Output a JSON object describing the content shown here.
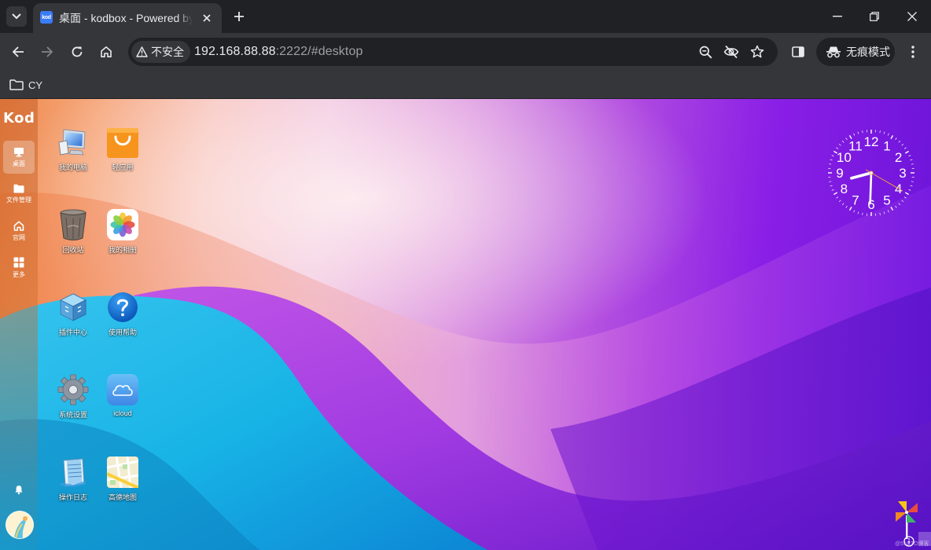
{
  "browser": {
    "tab": {
      "favicon_text": "kod",
      "title": "桌面 - kodbox - Powered by kodbox"
    },
    "security_label": "不安全",
    "url_host": "192.168.88.88",
    "url_rest": ":2222/#desktop",
    "incognito_label": "无痕模式",
    "bookmark_folder": "CY",
    "icons": [
      "tab-list-icon",
      "close-icon",
      "new-tab-icon",
      "minimize-icon",
      "restore-icon",
      "window-close-icon",
      "back-icon",
      "forward-icon",
      "reload-icon",
      "home-icon",
      "warning-icon",
      "zoom-icon",
      "eye-off-icon",
      "star-icon",
      "side-panel-icon",
      "incognito-icon",
      "menu-icon",
      "folder-icon"
    ]
  },
  "app": {
    "logo": "Kod",
    "sidebar": [
      {
        "label": "桌面",
        "icon": "desktop-icon",
        "active": true
      },
      {
        "label": "文件管理",
        "icon": "folder-icon",
        "active": false
      },
      {
        "label": "官网",
        "icon": "home-icon",
        "active": false
      },
      {
        "label": "更多",
        "icon": "grid-icon",
        "active": false
      }
    ],
    "desktop_icons": [
      {
        "label": "我的电脑",
        "icon": "computer-icon"
      },
      {
        "label": "轻应用",
        "icon": "shopping-bag-icon"
      },
      {
        "label": "回收站",
        "icon": "recycle-bin-icon"
      },
      {
        "label": "我的相册",
        "icon": "photos-icon"
      },
      {
        "label": "插件中心",
        "icon": "plugin-cube-icon"
      },
      {
        "label": "使用帮助",
        "icon": "help-icon"
      },
      {
        "label": "系统设置",
        "icon": "gear-icon"
      },
      {
        "label": "icloud",
        "icon": "cloud-icon"
      },
      {
        "label": "操作日志",
        "icon": "notepad-icon"
      },
      {
        "label": "高德地图",
        "icon": "map-icon"
      }
    ],
    "clock": {
      "hour": 8,
      "minute": 30,
      "second": 20,
      "numerals": [
        "12",
        "1",
        "2",
        "3",
        "4",
        "5",
        "6",
        "7",
        "8",
        "9",
        "10",
        "11"
      ]
    },
    "watermark": "@51CTO博客"
  }
}
